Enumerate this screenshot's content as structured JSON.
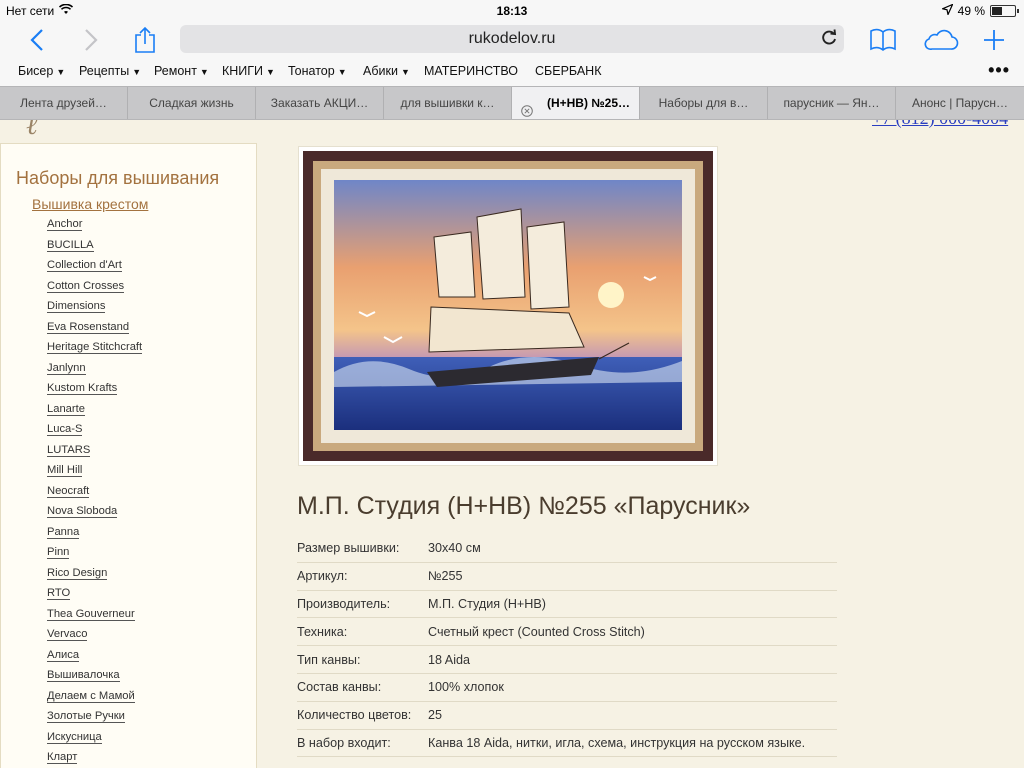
{
  "status": {
    "carrier": "Нет сети",
    "time": "18:13",
    "battery": "49 %",
    "battery_level": 0.49
  },
  "toolbar": {
    "url": "rukodelov.ru"
  },
  "bookmarks": [
    {
      "label": "Бисер",
      "menu": true
    },
    {
      "label": "Рецепты",
      "menu": true
    },
    {
      "label": "Ремонт",
      "menu": true
    },
    {
      "label": "КНИГИ",
      "menu": true
    },
    {
      "label": "Тонатор",
      "menu": true
    },
    {
      "label": "Абики",
      "menu": true
    },
    {
      "label": "МАТЕРИНСТВО",
      "menu": false
    },
    {
      "label": "СБЕРБАНК",
      "menu": false
    }
  ],
  "tabs": [
    {
      "label": "Лента друзей…",
      "active": false
    },
    {
      "label": "Сладкая жизнь",
      "active": false
    },
    {
      "label": "Заказать АКЦИ…",
      "active": false
    },
    {
      "label": "для вышивки к…",
      "active": false
    },
    {
      "label": "(Н+НВ) №25…",
      "active": true
    },
    {
      "label": "Наборы для в…",
      "active": false
    },
    {
      "label": "парусник — Ян…",
      "active": false
    },
    {
      "label": "Анонс | Парусн…",
      "active": false
    }
  ],
  "header": {
    "phone_fragment": "+7 (812) 000-4004"
  },
  "sidebar": {
    "title": "Наборы для вышивания",
    "subcategory": "Вышивка крестом",
    "brands": [
      "Anchor",
      "BUCILLA",
      "Collection d'Art",
      "Cotton Crosses",
      "Dimensions",
      "Eva Rosenstand",
      "Heritage Stitchcraft",
      "Janlynn",
      "Kustom Krafts",
      "Lanarte",
      "Luca-S",
      "LUTARS",
      "Mill Hill",
      "Neocraft",
      "Nova Sloboda",
      "Panna",
      "Pinn",
      "Rico Design",
      "RTO",
      "Thea Gouverneur",
      "Vervaco",
      "Алиса",
      "Вышивалочка",
      "Делаем с Мамой",
      "Золотые Ручки",
      "Искусница",
      "Кларт"
    ]
  },
  "product": {
    "title": "М.П. Студия (Н+НВ) №255 «Парусник»",
    "specs": [
      {
        "key": "Размер вышивки:",
        "value": "30x40 см"
      },
      {
        "key": "Артикул:",
        "value": "№255"
      },
      {
        "key": "Производитель:",
        "value": "М.П. Студия (Н+НВ)"
      },
      {
        "key": "Техника:",
        "value": "Счетный крест (Counted Cross Stitch)"
      },
      {
        "key": "Тип канвы:",
        "value": "18 Aida"
      },
      {
        "key": "Состав канвы:",
        "value": "100% хлопок"
      },
      {
        "key": "Количество цветов:",
        "value": "25"
      },
      {
        "key": "В набор входит:",
        "value": "Канва 18 Aida, нитки, игла, схема, инструкция на русском языке."
      }
    ]
  },
  "colors": {
    "accent_link": "#a3723f",
    "ios_blue": "#1a7ef5",
    "page_bg": "#f6f2e4"
  }
}
